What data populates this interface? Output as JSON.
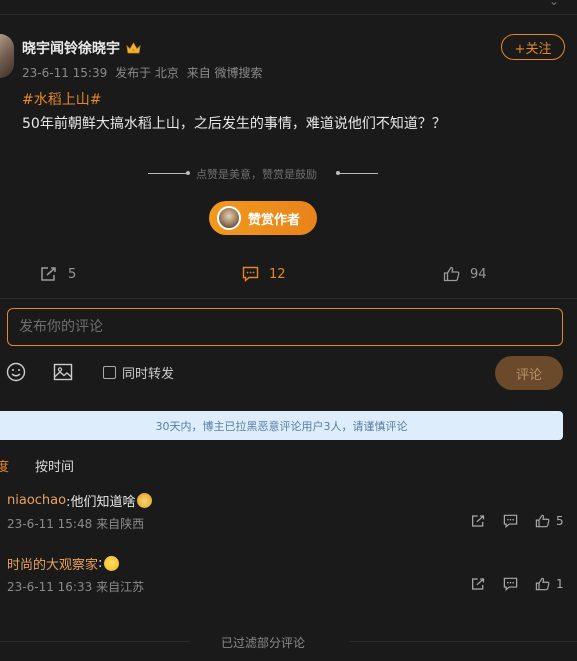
{
  "post": {
    "author": "晓宇闻铃徐晓宇",
    "meta_time": "23-6-11 15:39",
    "meta_location": "发布于 北京",
    "meta_source": "来自 微博搜索",
    "follow_label": "+关注",
    "hashtag": "#水稻上山#",
    "content": "50年前朝鲜大搞水稻上山，之后发生的事情，难道说他们不知道？？",
    "reward_prompt": "点赞是美意，赞赏是鼓励",
    "reward_button": "赞赏作者",
    "stats": {
      "reposts": "5",
      "comments": "12",
      "likes": "94"
    }
  },
  "composer": {
    "placeholder": "发布你的评论",
    "repost_label": "同时转发",
    "submit_label": "评论"
  },
  "notice": "30天内，博主已拉黑恶意评论用户3人，请谨慎评论",
  "sort_tabs": {
    "hot": "度",
    "by_time": "按时间"
  },
  "comments": [
    {
      "user": "niaochao",
      "text": ":他们知道啥",
      "emoji": "cat-emoji",
      "time": "23-6-11 15:48",
      "source": "来自陕西",
      "likes": "5"
    },
    {
      "user": "时尚的大观察家",
      "text": ":",
      "emoji": "shrug-emoji",
      "time": "23-6-11 16:33",
      "source": "来自江苏",
      "likes": "1"
    }
  ],
  "footer": "已过滤部分评论",
  "colors": {
    "accent": "#e4862a",
    "background": "#1a1a1a",
    "notice_bg": "#ddedfb"
  }
}
